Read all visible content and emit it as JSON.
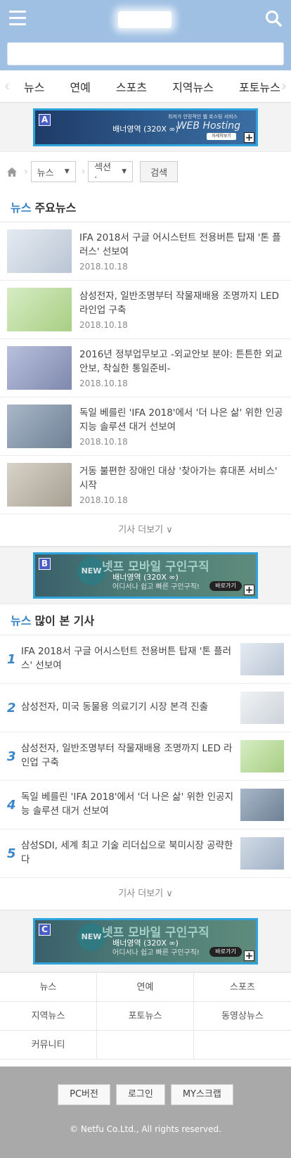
{
  "header": {
    "menu_icon": "hamburger-menu-icon",
    "search_icon": "search-icon",
    "search_placeholder": ""
  },
  "nav": {
    "items": [
      {
        "label": "뉴스"
      },
      {
        "label": "연예"
      },
      {
        "label": "스포츠"
      },
      {
        "label": "지역뉴스"
      },
      {
        "label": "포토뉴스"
      }
    ]
  },
  "banners": {
    "a": {
      "letter": "A",
      "text": "배너영역 (320X ∞)",
      "sub": "최저가 안정적인 웹 호스팅 서비스",
      "brand": "WEB Hosting",
      "button": "자세히보기"
    },
    "b": {
      "letter": "B",
      "text": "배너영역 (320X ∞)",
      "badge": "NEW",
      "headline": "넷프 모바일 구인구직",
      "sub": "어디서나 쉽고 빠른 구인구직!",
      "button": "바로가기"
    },
    "c": {
      "letter": "C",
      "text": "배너영역 (320X ∞)",
      "badge": "NEW",
      "headline": "넷프 모바일 구인구직",
      "sub": "어디서나 쉽고 빠른 구인구직!",
      "button": "바로가기"
    }
  },
  "breadcrumb": {
    "select1": "뉴스",
    "select2": "섹션 ·",
    "search_label": "검색"
  },
  "main_news": {
    "title_hl": "뉴스",
    "title": "주요뉴스",
    "items": [
      {
        "title": "IFA 2018서 구글 어시스턴트 전용버튼 탑재 '톤 플러스' 선보여",
        "date": "2018.10.18",
        "thumb_color": "#c9d4e0"
      },
      {
        "title": "삼성전자, 일반조명부터 작물재배용 조명까지 LED 라인업 구축",
        "date": "2018.10.18",
        "thumb_color": "#b9d7a2"
      },
      {
        "title": "2016년 정부업무보고 -외교안보 분야: 튼튼한 외교안보, 착실한 통일준비-",
        "date": "2018.10.18",
        "thumb_color": "#9da6c4"
      },
      {
        "title": "독일 베를린 'IFA 2018'에서 '더 나은 삶' 위한 인공지능 솔루션 대거 선보여",
        "date": "2018.10.18",
        "thumb_color": "#8f9fb4"
      },
      {
        "title": "거동 불편한 장애인 대상 '찾아가는 휴대폰 서비스' 시작",
        "date": "2018.10.18",
        "thumb_color": "#c4bfb4"
      }
    ],
    "more": "기사 더보기 ∨"
  },
  "popular": {
    "title_hl": "뉴스",
    "title": "많이 본 기사",
    "items": [
      {
        "num": "1",
        "title": "IFA 2018서 구글 어시스턴트 전용버튼 탑재 '톤 플러스' 선보여",
        "thumb_color": "#cdd6e0"
      },
      {
        "num": "2",
        "title": "삼성전자, 미국 동물용 의료기기 시장 본격 진출",
        "thumb_color": "#e2e6ea"
      },
      {
        "num": "3",
        "title": "삼성전자, 일반조명부터 작물재배용 조명까지 LED 라인업 구축",
        "thumb_color": "#b9d7a2"
      },
      {
        "num": "4",
        "title": "독일 베를린 'IFA 2018'에서 '더 나은 삶' 위한 인공지능 솔루션 대거 선보여",
        "thumb_color": "#8f9fb4"
      },
      {
        "num": "5",
        "title": "삼성SDI, 세계 최고 기술 리더십으로 북미시장 공략한다",
        "thumb_color": "#bcc8d6"
      }
    ],
    "more": "기사 더보기 ∨"
  },
  "bottom_nav": [
    {
      "label": "뉴스"
    },
    {
      "label": "연예"
    },
    {
      "label": "스포츠"
    },
    {
      "label": "지역뉴스"
    },
    {
      "label": "포토뉴스"
    },
    {
      "label": "동영상뉴스"
    },
    {
      "label": "커뮤니티"
    },
    {
      "label": ""
    },
    {
      "label": ""
    }
  ],
  "footer": {
    "buttons": [
      {
        "label": "PC버전"
      },
      {
        "label": "로그인"
      },
      {
        "label": "MY스크랩"
      }
    ],
    "copyright": "© Netfu Co.Ltd., All rights reserved."
  },
  "colors": {
    "header_bg": "#9fc0e3",
    "accent": "#3a86c8",
    "banner_border": "#2fa3dc",
    "footer_bg": "#a9a9a9"
  }
}
